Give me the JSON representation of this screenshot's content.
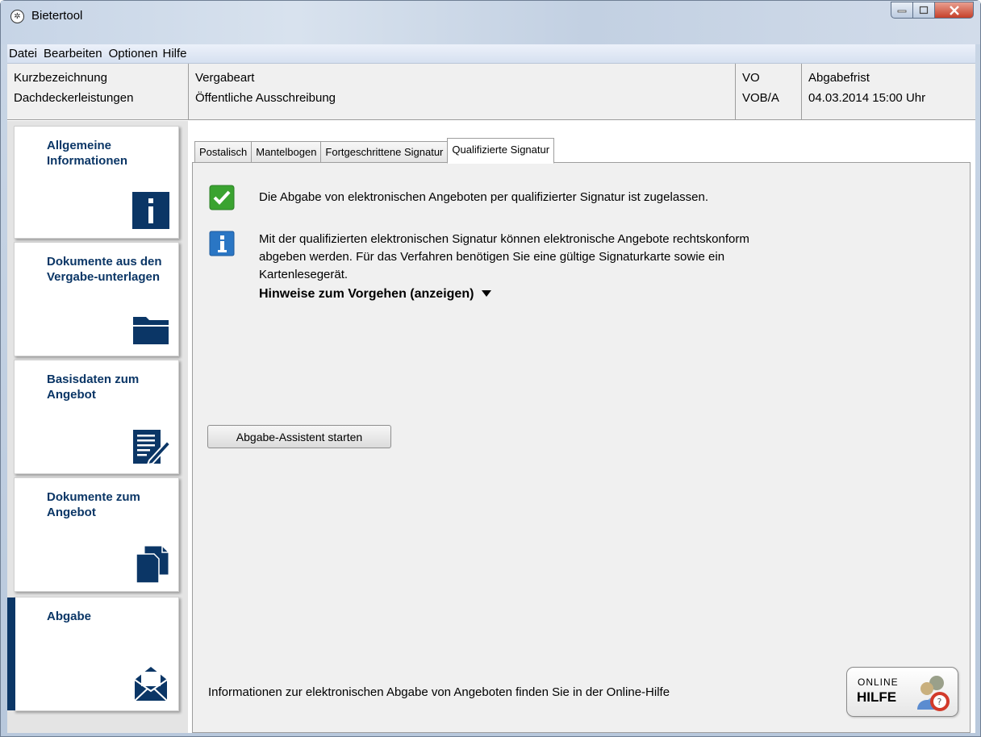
{
  "window": {
    "title": "Bietertool"
  },
  "menu": [
    "Datei",
    "Bearbeiten",
    "Optionen",
    "Hilfe"
  ],
  "header": [
    {
      "label": "Kurzbezeichnung",
      "value": "Dachdeckerleistungen"
    },
    {
      "label": "Vergabeart",
      "value": "Öffentliche Ausschreibung"
    },
    {
      "label": "VO",
      "value": "VOB/A"
    },
    {
      "label": "Abgabefrist",
      "value": "04.03.2014 15:00 Uhr"
    }
  ],
  "sidebar": [
    {
      "label": "Allgemeine Informationen",
      "icon": "info-icon"
    },
    {
      "label": "Dokumente aus den Vergabe-unterlagen",
      "icon": "folder-icon"
    },
    {
      "label": "Basisdaten zum Angebot",
      "icon": "edit-document-icon"
    },
    {
      "label": "Dokumente zum Angebot",
      "icon": "documents-icon"
    },
    {
      "label": "Abgabe",
      "icon": "envelope-icon",
      "active": true
    }
  ],
  "tabs": [
    "Postalisch",
    "Mantelbogen",
    "Fortgeschrittene Signatur",
    "Qualifizierte Signatur"
  ],
  "active_tab": "Qualifizierte Signatur",
  "panel": {
    "allowed_message": "Die Abgabe von elektronischen Angeboten per qualifizierter Signatur ist zugelassen.",
    "info_line1": "Mit der qualifizierten elektronischen Signatur können elektronische Angebote rechtskonform",
    "info_line2": "abgeben werden.  Für das Verfahren benötigen Sie eine gültige Signaturkarte sowie ein",
    "info_line3": "Kartenlesegerät.",
    "hint_toggle": "Hinweise zum Vorgehen (anzeigen)",
    "assistant_button": "Abgabe-Assistent starten",
    "footer": "Informationen zur elektronischen Abgabe von Angeboten finden Sie in der Online-Hilfe",
    "help_online": "ONLINE",
    "help_hilfe": "HILFE"
  },
  "colors": {
    "accent": "#0b3666",
    "check": "#3aa330",
    "info": "#2a76c4"
  }
}
